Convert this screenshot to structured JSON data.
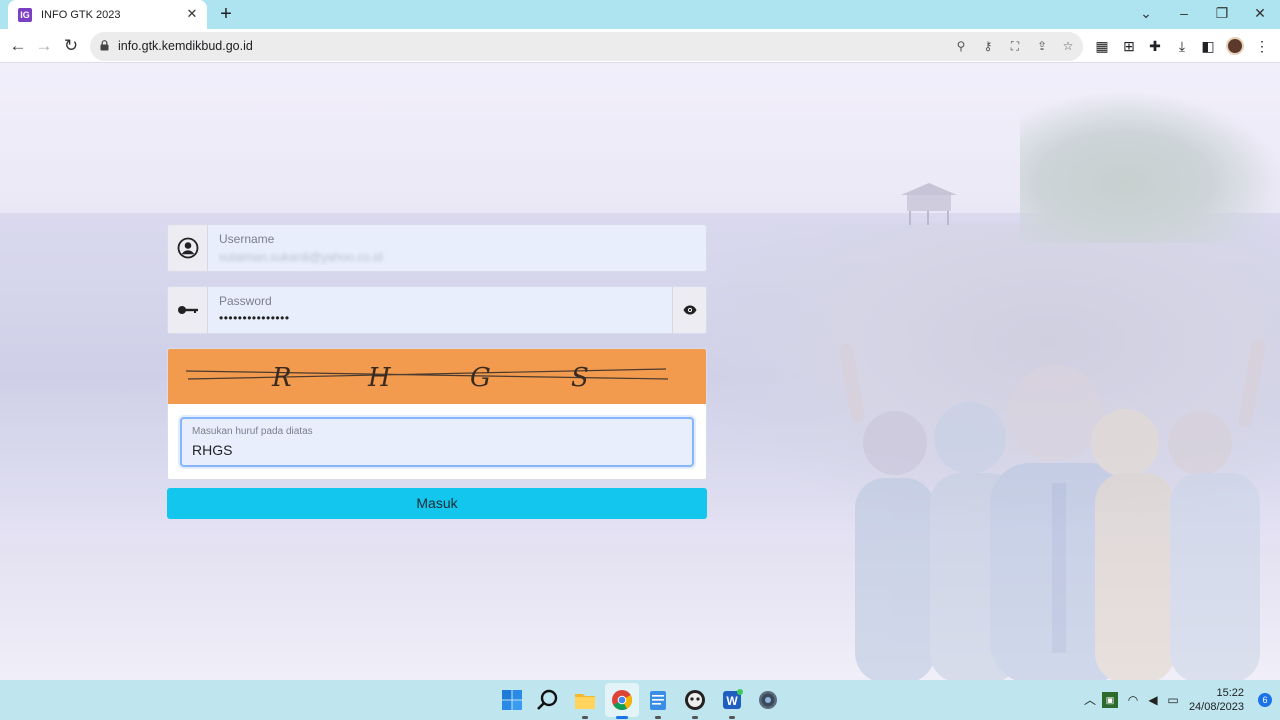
{
  "browser": {
    "tab_title": "INFO GTK 2023",
    "tab_favicon_text": "IG",
    "url": "info.gtk.kemdikbud.go.id",
    "new_tab_glyph": "+",
    "close_glyph": "✕"
  },
  "login": {
    "username_label": "Username",
    "username_value": "sulaiman.sukardi@yahoo.co.id",
    "password_label": "Password",
    "password_value": "•••••••••••••••",
    "captcha_letters": [
      "R",
      "H",
      "G",
      "S"
    ],
    "captcha_input_label": "Masukan huruf pada diatas",
    "captcha_input_value": "RHGS",
    "submit_label": "Masuk"
  },
  "taskbar": {
    "time": "15:22",
    "date": "24/08/2023",
    "notification_count": "6"
  },
  "colors": {
    "captcha_bg": "#f29a4d",
    "submit_bg": "#13c6ee",
    "input_bg": "#e8eefb",
    "titlebar_bg": "#aee4ef",
    "taskbar_bg": "#bfe6ee"
  },
  "icons": [
    "user-circle-icon",
    "key-icon",
    "eye-icon",
    "lock-icon",
    "search-icon",
    "star-icon",
    "extensions-icon",
    "download-icon"
  ]
}
